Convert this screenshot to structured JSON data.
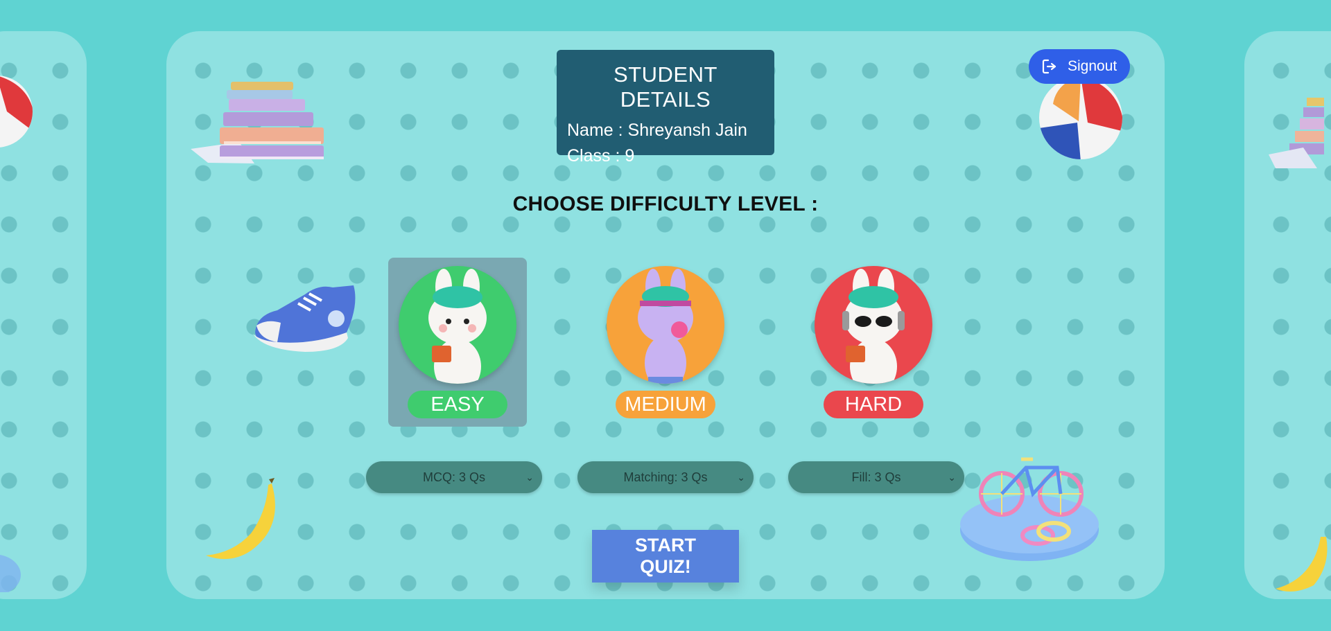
{
  "student": {
    "title": "STUDENT DETAILS",
    "name_line": "Name : Shreyansh Jain",
    "class_line": "Class : 9"
  },
  "signout": {
    "label": "Signout",
    "icon": "logout-icon"
  },
  "choose_heading": "CHOOSE DIFFICULTY LEVEL :",
  "levels": [
    {
      "label": "EASY",
      "color": "#3fcc6e",
      "selected": true
    },
    {
      "label": "MEDIUM",
      "color": "#f7a23a",
      "selected": false
    },
    {
      "label": "HARD",
      "color": "#ea474d",
      "selected": false
    }
  ],
  "question_selects": [
    {
      "value": "MCQ: 3 Qs"
    },
    {
      "value": "Matching: 3 Qs"
    },
    {
      "value": "Fill: 3 Qs"
    }
  ],
  "start_button": {
    "label_line1": "START",
    "label_line2": "QUIZ!"
  },
  "colors": {
    "background": "#5fd3d2",
    "panel": "#8fe1e1",
    "details_box": "#215d72",
    "signout": "#2f5fe8",
    "start": "#5782dd",
    "select": "#468a82"
  }
}
